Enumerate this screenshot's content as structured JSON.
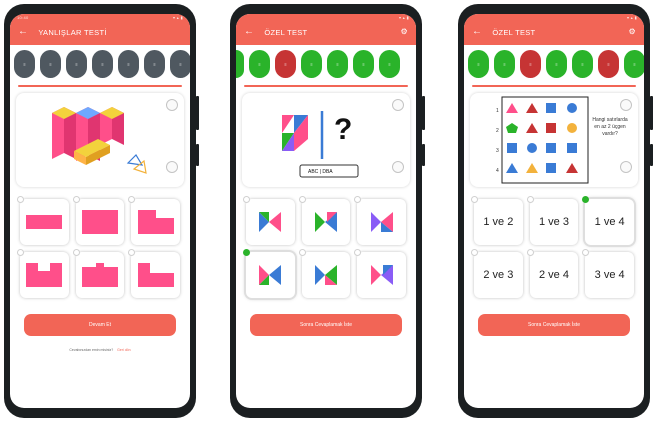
{
  "colors": {
    "brand": "#f26556",
    "correct": "#2ab32a",
    "wrong": "#c63434",
    "pending": "#4f5860",
    "shape_pink": "#ff4f8a"
  },
  "phone1": {
    "status_time": "10:40",
    "title": "YANLIŞLAR TESTİ",
    "question_count": 7,
    "button": "Devam Et",
    "footer_text": "Cevabınızdan emin misiniz?",
    "footer_link": "Geri dön"
  },
  "phone2": {
    "title": "ÖZEL TEST",
    "question_states": [
      "green",
      "green",
      "red",
      "green",
      "green",
      "green",
      "green"
    ],
    "question_mark": "?",
    "caption": "ABC | DBA",
    "selected_option": 4,
    "button": "Sonra Cevaplamak İste"
  },
  "phone3": {
    "title": "ÖZEL TEST",
    "question_states": [
      "green",
      "green",
      "red",
      "green",
      "green",
      "red",
      "green"
    ],
    "row_numbers": [
      "1",
      "2",
      "3",
      "4"
    ],
    "question": "Hangi satırlarda en az 2 üçgen vardır?",
    "options": [
      "1 ve 2",
      "1 ve 3",
      "1 ve 4",
      "2 ve 3",
      "2 ve 4",
      "3 ve 4"
    ],
    "selected_option": 3,
    "button": "Sonra Cevaplamak İste"
  }
}
